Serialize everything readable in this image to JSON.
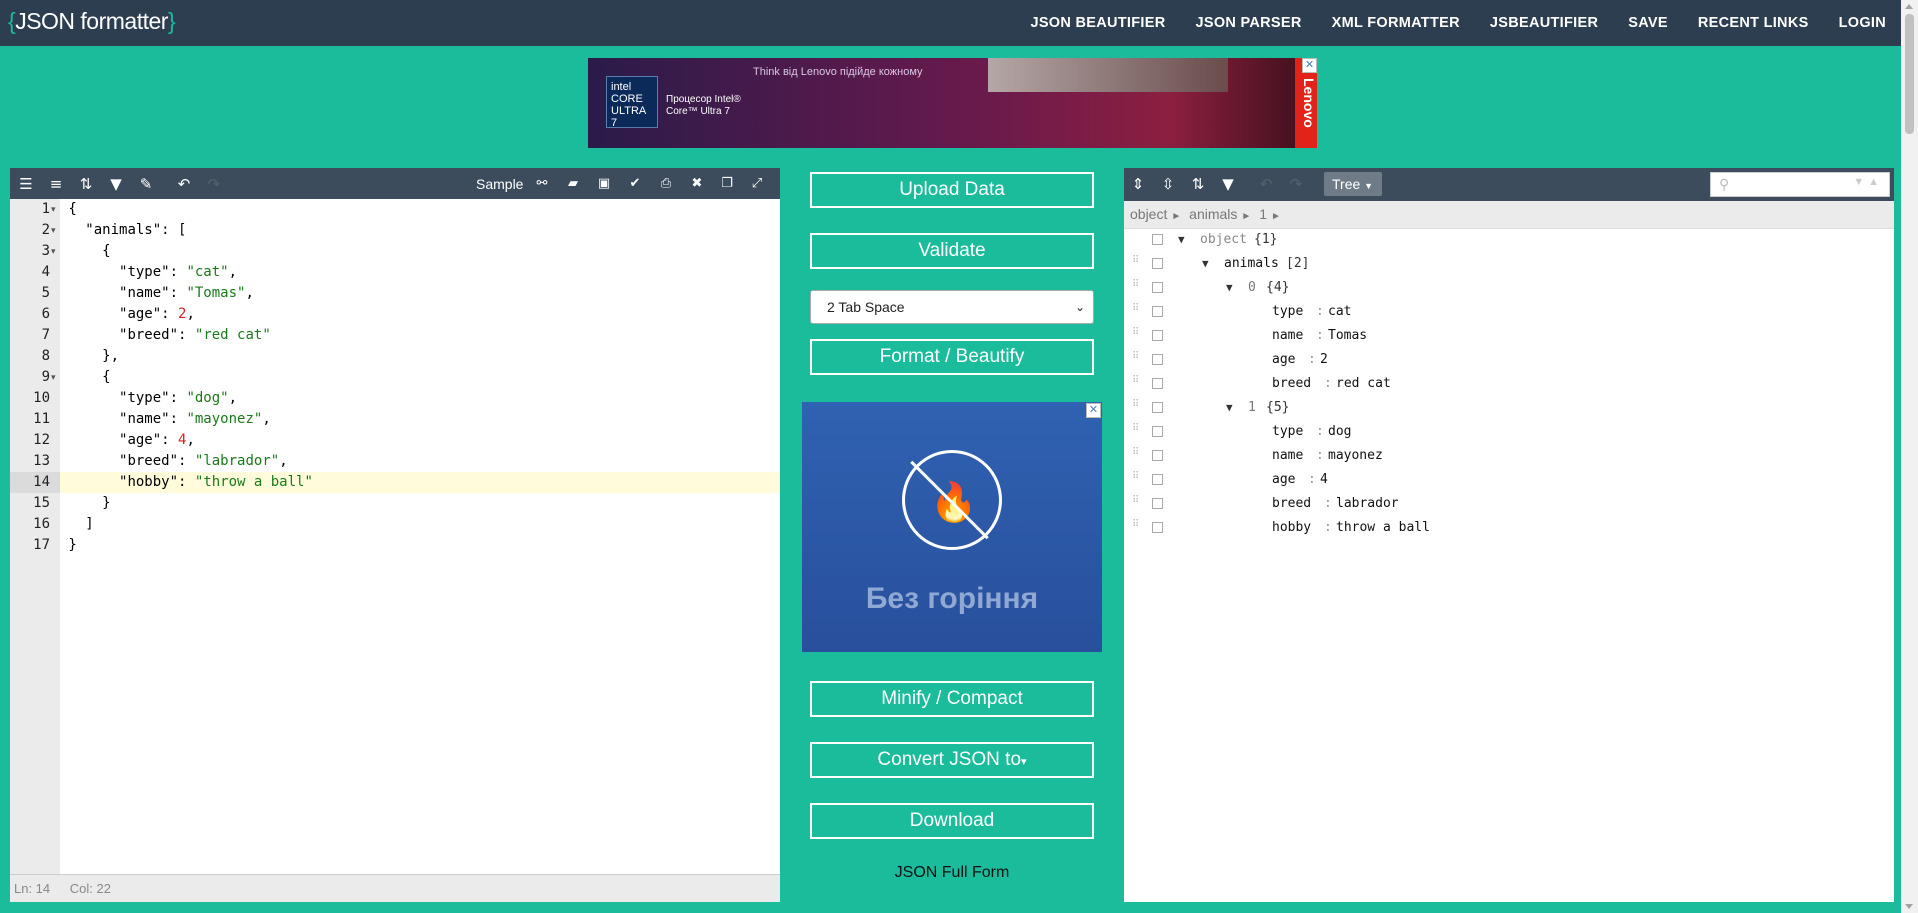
{
  "header": {
    "logo_text": "JSON formatter",
    "logo_open": "{",
    "logo_close": "}",
    "nav": [
      "JSON BEAUTIFIER",
      "JSON PARSER",
      "XML FORMATTER",
      "JSBEAUTIFIER",
      "SAVE",
      "RECENT LINKS",
      "LOGIN"
    ]
  },
  "ad_top": {
    "tagline": "Think від Lenovo підійде кожному",
    "chip": "intel CORE ULTRA 7",
    "product": "Процесор Intel® Core™ Ultra 7",
    "brand": "Lenovo",
    "close": "✕"
  },
  "editor": {
    "toolbar": {
      "sample_label": "Sample"
    },
    "line_numbers": [
      "1",
      "2",
      "3",
      "4",
      "5",
      "6",
      "7",
      "8",
      "9",
      "10",
      "11",
      "12",
      "13",
      "14",
      "15",
      "16",
      "17"
    ],
    "status": {
      "ln": "Ln: 14",
      "col": "Col: 22"
    }
  },
  "controls": {
    "upload": "Upload Data",
    "validate": "Validate",
    "indent_option": "2 Tab Space",
    "format": "Format / Beautify",
    "minify": "Minify / Compact",
    "convert": "Convert JSON to",
    "download": "Download",
    "full_form": "JSON Full Form"
  },
  "ad_mid": {
    "caption": "Без горіння"
  },
  "tree": {
    "mode": "Tree",
    "breadcrumb": [
      "object",
      "►",
      "animals",
      "►",
      "1",
      "►"
    ],
    "rows": [
      {
        "label": "object",
        "meta": "{1}"
      },
      {
        "label": "animals",
        "meta": "[2]"
      },
      {
        "label": "0",
        "meta": "{4}"
      },
      {
        "key": "type",
        "value": "cat"
      },
      {
        "key": "name",
        "value": "Tomas"
      },
      {
        "key": "age",
        "value": "2"
      },
      {
        "key": "breed",
        "value": "red cat"
      },
      {
        "label": "1",
        "meta": "{5}"
      },
      {
        "key": "type",
        "value": "dog"
      },
      {
        "key": "name",
        "value": "mayonez"
      },
      {
        "key": "age",
        "value": "4"
      },
      {
        "key": "breed",
        "value": "labrador"
      },
      {
        "key": "hobby",
        "value": "throw a ball"
      }
    ]
  },
  "colors": {
    "accent": "#1abc9c",
    "header_bg": "#2c3e50",
    "toolbar_bg": "#3d4c5c",
    "string": "#1a7a1a",
    "number": "#d62222"
  }
}
